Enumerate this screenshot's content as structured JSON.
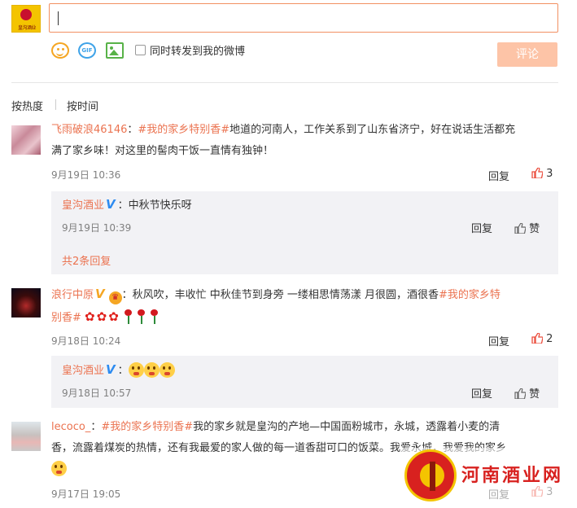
{
  "composer": {
    "avatar_brand": "皇沟酒业",
    "input_value": "",
    "repost_label": "同时转发到我的微博",
    "submit_label": "评论",
    "tools": [
      "emoji-icon",
      "gif-icon",
      "image-icon"
    ]
  },
  "sort": {
    "hot": "按热度",
    "time": "按时间"
  },
  "comments": [
    {
      "nick": "飞雨破浪46146",
      "colon": "：",
      "tag": "#我的家乡特别香#",
      "text1": "地道的河南人，工作关系到了山东省济宁，好在说话生活都充",
      "text2": "满了家乡味！对这里的髻肉干饭一直情有独钟！",
      "time": "9月19日 10:36",
      "reply": "回复",
      "likes": "3",
      "replies": [
        {
          "nick": "皇沟酒业",
          "badge": "V",
          "text": "：中秋节快乐呀",
          "time": "9月19日 10:39",
          "reply": "回复",
          "like": "赞"
        }
      ],
      "more_replies": "共2条回复"
    },
    {
      "nick": "浪行中原",
      "badge": "V",
      "text1": "：秋风吹，丰收忙 中秋佳节到身旁 一缕相思情荡漾 月很圆，酒很香",
      "tag_a": "#我的家乡特",
      "tag_b": "别香#",
      "time": "9月18日 10:24",
      "reply": "回复",
      "likes": "2",
      "replies": [
        {
          "nick": "皇沟酒业",
          "badge": "V",
          "text": "：",
          "time": "9月18日 10:57",
          "reply": "回复",
          "like": "赞"
        }
      ]
    },
    {
      "nick": "lecoco_",
      "colon": "：",
      "tag": "#我的家乡特别香#",
      "text1": "我的家乡就是皇沟的产地—中国面粉城市，永城，透露着小麦的清",
      "text2": "香，流露着煤炭的热情，还有我最爱的家人做的每一道香甜可口的饭菜。我爱永城，我爱我的家乡",
      "time": "9月17日 19:05",
      "reply": "回复",
      "likes": "3"
    }
  ],
  "watermark": {
    "text": "河南酒业网"
  },
  "colors": {
    "accent": "#eb7350",
    "vip_blue": "#2d8bf0",
    "submit_disabled": "#fdc4a7",
    "sub_box": "#f2f2f5"
  }
}
